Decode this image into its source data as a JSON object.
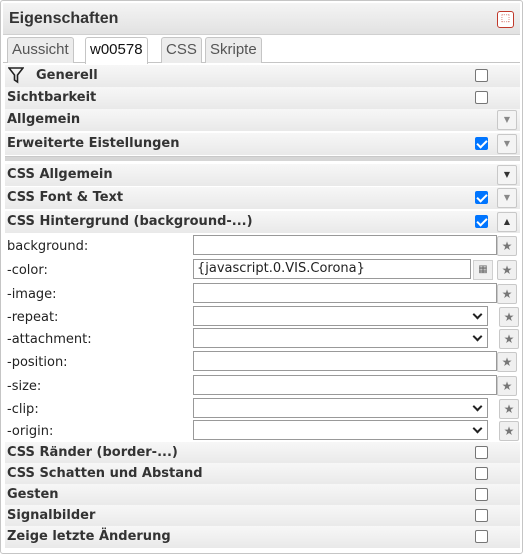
{
  "panel": {
    "title": "Eigenschaften",
    "close_icon": "⬚"
  },
  "tabs": [
    {
      "label": "Aussicht"
    },
    {
      "label": "w00578"
    },
    {
      "label": "CSS"
    },
    {
      "label": "Skripte"
    }
  ],
  "groups_top": [
    {
      "label": "Generell",
      "checked": false
    },
    {
      "label": "Sichtbarkeit",
      "checked": false
    },
    {
      "label": "Allgemein",
      "dropdown": "▼"
    },
    {
      "label": "Erweiterte Eistellungen",
      "checked": true,
      "dropdown": "▼"
    }
  ],
  "css_groups": [
    {
      "label": "CSS Allgemein",
      "dropdown": "▼"
    },
    {
      "label": "CSS Font & Text",
      "checked": true,
      "dropdown": "▼"
    },
    {
      "label": "CSS Hintergrund (background-...)",
      "checked": true,
      "dropdown": "▲"
    }
  ],
  "background_props": [
    {
      "label": "background:",
      "value": ""
    },
    {
      "label": "-color:",
      "value": "{javascript.0.VIS.Corona}"
    },
    {
      "label": "-image:",
      "value": ""
    },
    {
      "label": "-repeat:",
      "value": ""
    },
    {
      "label": "-attachment:",
      "value": ""
    },
    {
      "label": "-position:",
      "value": ""
    },
    {
      "label": "-size:",
      "value": ""
    },
    {
      "label": "-clip:",
      "value": ""
    },
    {
      "label": "-origin:",
      "value": ""
    }
  ],
  "groups_bottom": [
    {
      "label": "CSS Ränder (border-...)"
    },
    {
      "label": "CSS Schatten und Abstand"
    },
    {
      "label": "Gesten"
    },
    {
      "label": "Signalbilder"
    },
    {
      "label": "Zeige letzte Änderung"
    }
  ],
  "icons": {
    "star": "★",
    "binding": "▦",
    "filter": "filter-icon"
  }
}
